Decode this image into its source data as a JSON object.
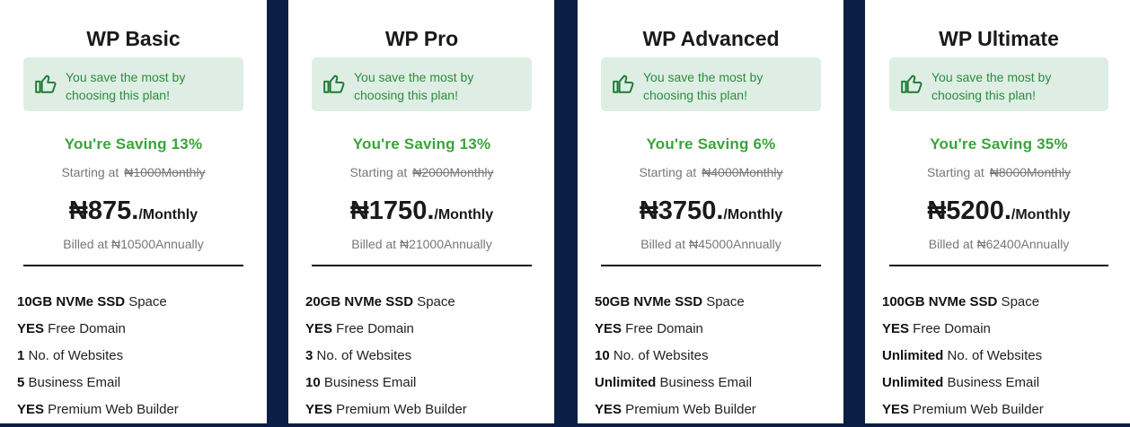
{
  "save_message": "You save the most by choosing this plan!",
  "colors": {
    "card_bg": "#ffffff",
    "page_bg": "#0b1f45",
    "saving_green": "#3aa43a",
    "save_box_bg": "#deeee4"
  },
  "starting_label": "Starting at",
  "plans": [
    {
      "name": "WP Basic",
      "saving": "You're Saving 13%",
      "old_price": "₦1000Monthly",
      "price": "₦875.",
      "per": "/Monthly",
      "billed": "Billed at ₦10500Annually",
      "features": [
        {
          "strong": "10GB NVMe SSD",
          "text": " Space"
        },
        {
          "strong": "YES",
          "text": " Free Domain"
        },
        {
          "strong": "1",
          "text": " No. of Websites"
        },
        {
          "strong": "5",
          "text": " Business Email"
        },
        {
          "strong": "YES",
          "text": " Premium Web Builder"
        }
      ]
    },
    {
      "name": "WP Pro",
      "saving": "You're Saving 13%",
      "old_price": "₦2000Monthly",
      "price": "₦1750.",
      "per": "/Monthly",
      "billed": "Billed at ₦21000Annually",
      "features": [
        {
          "strong": "20GB NVMe SSD",
          "text": " Space"
        },
        {
          "strong": "YES",
          "text": " Free Domain"
        },
        {
          "strong": "3",
          "text": " No. of Websites"
        },
        {
          "strong": "10",
          "text": " Business Email"
        },
        {
          "strong": "YES",
          "text": " Premium Web Builder"
        }
      ]
    },
    {
      "name": "WP Advanced",
      "saving": "You're Saving 6%",
      "old_price": "₦4000Monthly",
      "price": "₦3750.",
      "per": "/Monthly",
      "billed": "Billed at ₦45000Annually",
      "features": [
        {
          "strong": "50GB NVMe SSD",
          "text": " Space"
        },
        {
          "strong": "YES",
          "text": " Free Domain"
        },
        {
          "strong": "10",
          "text": " No. of Websites"
        },
        {
          "strong": "Unlimited",
          "text": " Business Email"
        },
        {
          "strong": "YES",
          "text": " Premium Web Builder"
        }
      ]
    },
    {
      "name": "WP Ultimate",
      "saving": "You're Saving 35%",
      "old_price": "₦8000Monthly",
      "price": "₦5200.",
      "per": "/Monthly",
      "billed": "Billed at ₦62400Annually",
      "features": [
        {
          "strong": "100GB NVMe SSD",
          "text": " Space"
        },
        {
          "strong": "YES",
          "text": " Free Domain"
        },
        {
          "strong": "Unlimited",
          "text": " No. of Websites"
        },
        {
          "strong": "Unlimited",
          "text": " Business Email"
        },
        {
          "strong": "YES",
          "text": " Premium Web Builder"
        }
      ]
    }
  ]
}
